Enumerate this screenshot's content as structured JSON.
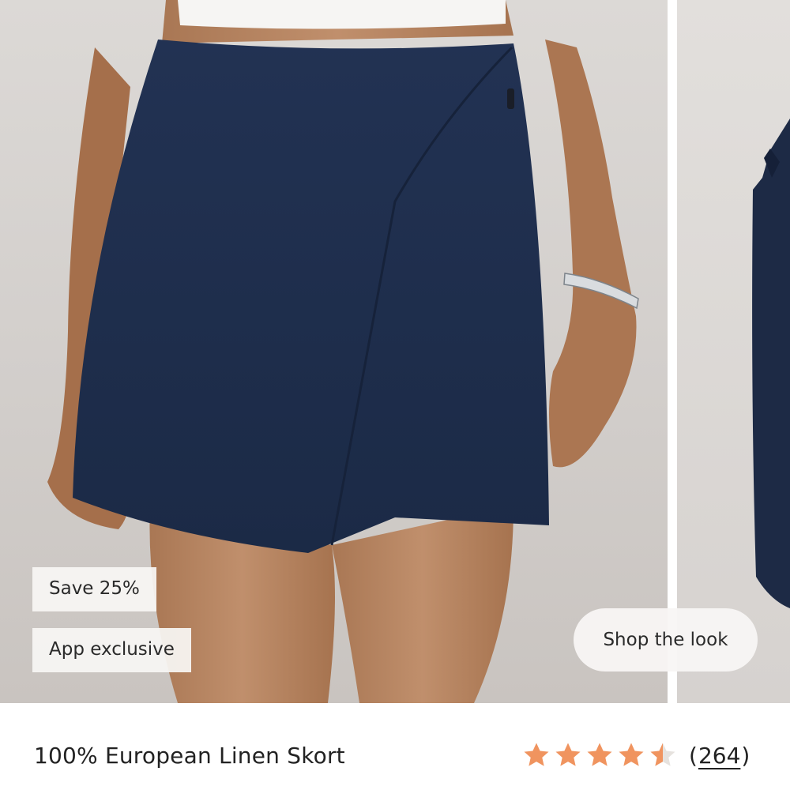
{
  "badges": {
    "discount": "Save 25%",
    "exclusive": "App exclusive"
  },
  "gallery": {
    "shop_the_look": "Shop the look",
    "main_image": "navy linen wrap skort on model",
    "next_image": "navy skort partial view"
  },
  "product": {
    "title": "100% European Linen Skort",
    "rating": 4.5,
    "rating_max": 5,
    "review_count": "264",
    "review_open": "(",
    "review_close": ")"
  },
  "colors": {
    "star": "#f0945f",
    "star_empty": "#e6e2de",
    "skirt": "#1f2f4d",
    "text": "#222222"
  },
  "icons": {
    "star": "star-icon",
    "half_star": "half-star-icon"
  }
}
